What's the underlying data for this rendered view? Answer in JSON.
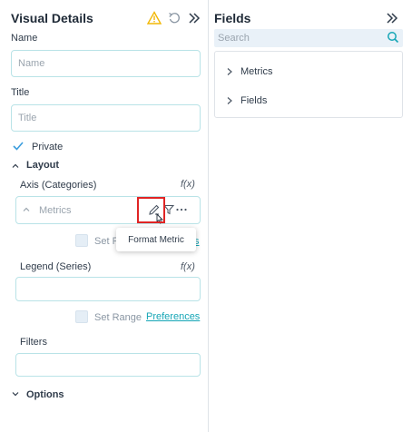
{
  "visual_details": {
    "title": "Visual Details",
    "icons": [
      "warning-icon",
      "undo-icon",
      "collapse-icon"
    ],
    "name_label": "Name",
    "name_placeholder": "Name",
    "title_label": "Title",
    "title_placeholder": "Title",
    "private_label": "Private",
    "private_checked": true,
    "layout_label": "Layout",
    "axis_label": "Axis (Categories)",
    "axis_fx": "f(x)",
    "axis_item": "Metrics",
    "axis_set_range": "Set R",
    "axis_pref_fragment": "s",
    "tooltip": "Format Metric",
    "legend_label": "Legend (Series)",
    "legend_fx": "f(x)",
    "legend_set_range": "Set Range",
    "legend_preferences": "Preferences",
    "filters_label": "Filters",
    "options_label": "Options"
  },
  "fields_panel": {
    "title": "Fields",
    "search_placeholder": "Search",
    "tree": [
      "Metrics",
      "Fields"
    ]
  },
  "colors": {
    "accent": "#16a6b6",
    "warning": "#f2b705",
    "highlight": "#e02424",
    "input_border": "#b9e3e7"
  }
}
